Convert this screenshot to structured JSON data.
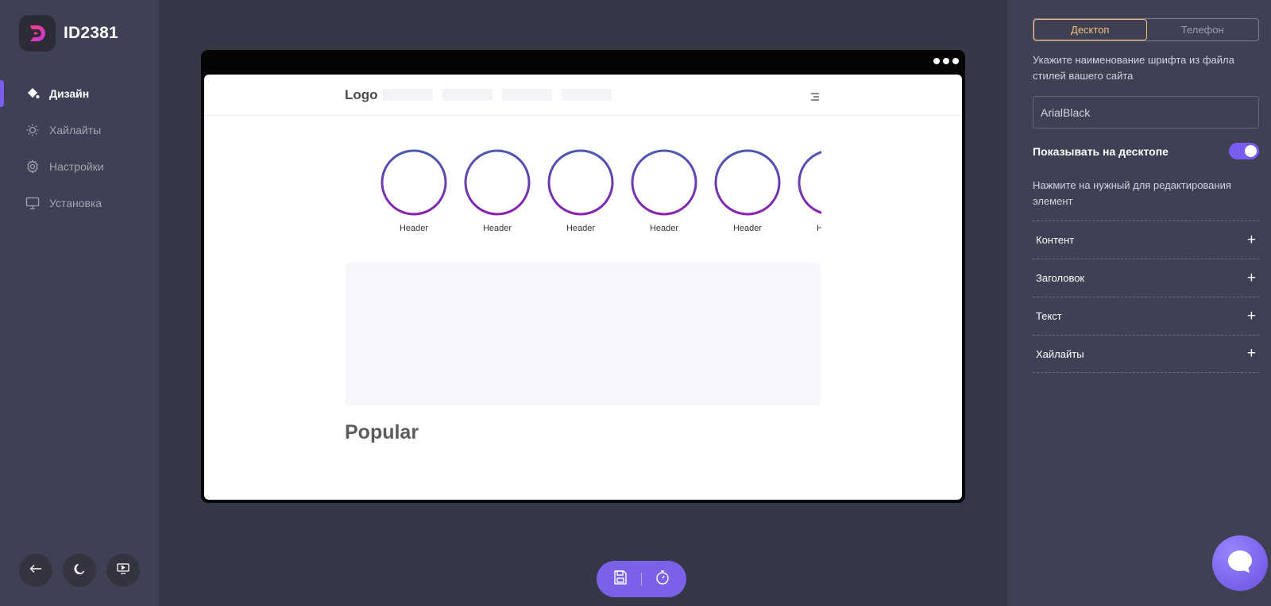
{
  "brand": {
    "name": "ID2381"
  },
  "sidebar": {
    "items": [
      {
        "label": "Дизайн",
        "icon": "paint-bucket-icon",
        "active": true
      },
      {
        "label": "Хайлайты",
        "icon": "sun-icon",
        "active": false
      },
      {
        "label": "Настройки",
        "icon": "gear-icon",
        "active": false
      },
      {
        "label": "Установка",
        "icon": "monitor-icon",
        "active": false
      }
    ],
    "bottom_buttons": [
      {
        "icon": "back-arrow-icon"
      },
      {
        "icon": "moon-icon"
      },
      {
        "icon": "preview-icon"
      }
    ]
  },
  "preview": {
    "logo": "Logo",
    "stories": [
      {
        "label": "Header"
      },
      {
        "label": "Header"
      },
      {
        "label": "Header"
      },
      {
        "label": "Header"
      },
      {
        "label": "Header"
      },
      {
        "label": "Header"
      }
    ],
    "section_title": "Popular"
  },
  "toolbar": {
    "buttons": [
      {
        "icon": "save-icon"
      },
      {
        "icon": "timer-icon"
      }
    ]
  },
  "panel": {
    "tabs": [
      {
        "label": "Десктоп",
        "active": true
      },
      {
        "label": "Телефон",
        "active": false
      }
    ],
    "font_hint": "Укажите наименование шрифта из файла стилей вашего сайта",
    "font_value": "ArialBlack",
    "show_desktop_label": "Показывать на десктопе",
    "show_desktop_enabled": true,
    "edit_hint": "Нажмите на нужный для редактирования элемент",
    "sections": [
      {
        "label": "Контент"
      },
      {
        "label": "Заголовок"
      },
      {
        "label": "Текст"
      },
      {
        "label": "Хайлайты"
      }
    ]
  },
  "colors": {
    "accent": "#7a5cf0",
    "tab_active": "#f3c078",
    "background": "#353747",
    "panel": "#3e4053"
  },
  "chat": {
    "icon": "chat-bubble-icon"
  }
}
